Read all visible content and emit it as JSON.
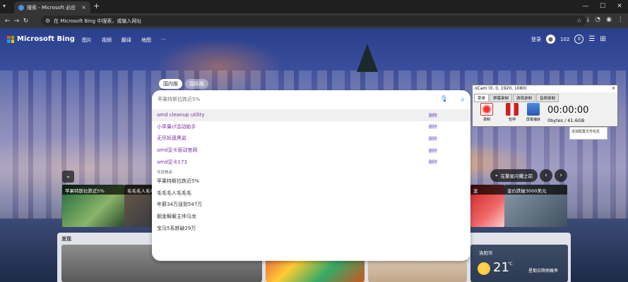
{
  "browser": {
    "tab_title": "搜索 - Microsoft 必应",
    "omnibox_placeholder": "在 Microsoft Bing 中搜索，或输入网址"
  },
  "bing": {
    "logo_text": "Microsoft Bing",
    "nav": [
      "图片",
      "视频",
      "翻译",
      "地图",
      "···"
    ],
    "login": "登录",
    "points": "102"
  },
  "region": {
    "domestic": "国内版",
    "international": "国际版"
  },
  "search": {
    "placeholder": "苹果特斯拉跌近5%",
    "history": [
      {
        "q": "amd cleanup utility",
        "del": "删除"
      },
      {
        "q": "小苹果cf活动助手",
        "del": "删除"
      },
      {
        "q": "无尽妖遗黑岩",
        "del": "删除"
      },
      {
        "q": "amd显卡驱动官网",
        "del": "删除"
      },
      {
        "q": "amd显卡173",
        "del": "删除"
      }
    ],
    "trending_title": "今日热点",
    "trending": [
      "苹果特斯拉跌近5%",
      "毛毛毛人毛毛毛",
      "年薪34万涨到547万",
      "掘金解雇主帅马龙",
      "宝马5系跌破29万"
    ]
  },
  "cards": {
    "left1": "苹果特斯拉跌近5%",
    "left2": "毛毛毛人毛毛毛",
    "right1": "龙",
    "right2": "金价跌破3000美元"
  },
  "location_label": "在繁星闪耀之前",
  "discover": {
    "title": "发现",
    "weather_location": "洛阳市",
    "temperature": "21",
    "temp_unit": "℃",
    "forecast": "星期日降雨概率"
  },
  "ocam": {
    "title": "oCam (0, 0, 1920, 1080)",
    "tabs": [
      "菜单",
      "屏幕录制",
      "游戏录制",
      "音频录制"
    ],
    "record": "录制",
    "pause": "暂停",
    "capture": "屏幕捕获",
    "time": "00:00:00",
    "size": "0bytes / 61.6GB",
    "tip": "添加配置文件信息"
  }
}
